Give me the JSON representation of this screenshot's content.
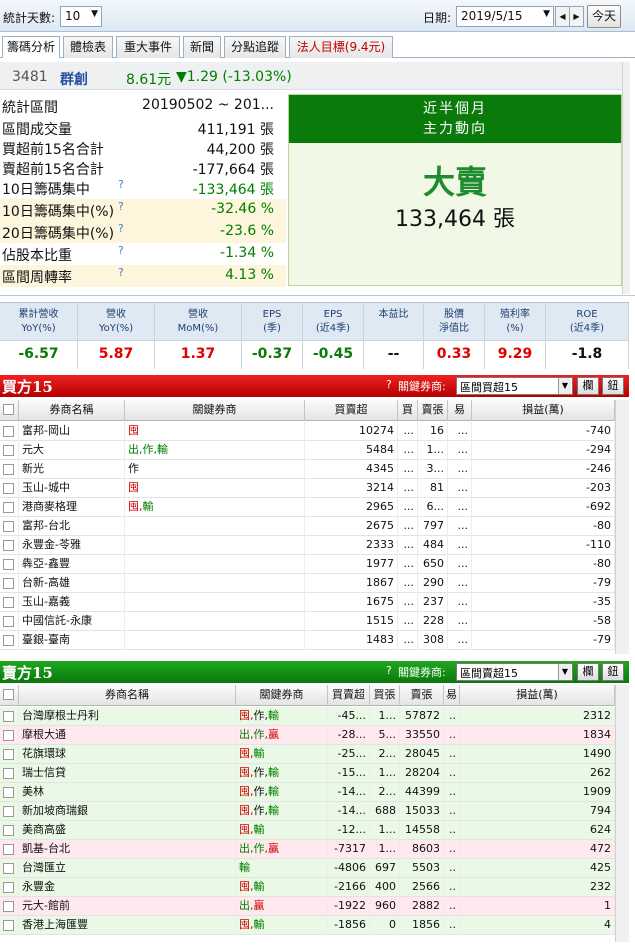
{
  "toolbar": {
    "days_label": "統計天數:",
    "days_value": "10",
    "date_label": "日期:",
    "date_value": "2019/5/15",
    "today_button": "今天"
  },
  "tabs": [
    {
      "label": "籌碼分析"
    },
    {
      "label": "體檢表"
    },
    {
      "label": "重大事件"
    },
    {
      "label": "新聞"
    },
    {
      "label": "分點追蹤"
    },
    {
      "label": "法人目標(9.4元)"
    }
  ],
  "stock": {
    "code": "3481",
    "name": "群創",
    "price": "8.61元",
    "change": "▼1.29 (-13.03%)"
  },
  "stats": [
    {
      "label": "統計區間",
      "value": "20190502 ~ 201..."
    },
    {
      "label": "區間成交量",
      "value": "411,191 張"
    },
    {
      "label": "買超前15名合計",
      "value": "44,200 張"
    },
    {
      "label": "賣超前15名合計",
      "value": "-177,664 張"
    },
    {
      "label": "10日籌碼集中",
      "value": "-133,464 張",
      "help": "?"
    },
    {
      "label": "10日籌碼集中(%)",
      "value": "-32.46 %",
      "help": "?"
    },
    {
      "label": "20日籌碼集中(%)",
      "value": "-23.6 %",
      "help": "?"
    },
    {
      "label": "佔股本比重",
      "value": "-1.34 %",
      "help": "?"
    },
    {
      "label": "區間周轉率",
      "value": "4.13 %",
      "help": "?"
    }
  ],
  "trend": {
    "line1": "近半個月",
    "line2": "主力動向",
    "verdict": "大賣",
    "amount": "133,464 張"
  },
  "metrics": [
    {
      "h1": "累計營收",
      "h2": "YoY(%)",
      "v": "-6.57",
      "color": "#0a7a0a"
    },
    {
      "h1": "營收",
      "h2": "YoY(%)",
      "v": "5.87",
      "color": "#e00000"
    },
    {
      "h1": "營收",
      "h2": "MoM(%)",
      "v": "1.37",
      "color": "#e00000"
    },
    {
      "h1": "EPS",
      "h2": "(季)",
      "v": "-0.37",
      "color": "#0a7a0a"
    },
    {
      "h1": "EPS",
      "h2": "(近4季)",
      "v": "-0.45",
      "color": "#0a7a0a"
    },
    {
      "h1": "本益比",
      "h2": "",
      "v": "--",
      "color": "#111111"
    },
    {
      "h1": "股價",
      "h2": "淨值比",
      "v": "0.33",
      "color": "#e00000"
    },
    {
      "h1": "殖利率",
      "h2": "(%)",
      "v": "9.29",
      "color": "#e00000"
    },
    {
      "h1": "ROE",
      "h2": "(近4季)",
      "v": "-1.8",
      "color": "#111111"
    }
  ],
  "buy": {
    "title": "買方15",
    "qmark": "?",
    "key_label": "關鍵券商:",
    "select": "區間買超15",
    "btn1": "欄",
    "btn2": "鈕",
    "columns": [
      "",
      "券商名稱",
      "關鍵券商",
      "買賣超",
      "買",
      "賣張",
      "易",
      "損益(萬)"
    ],
    "rows": [
      {
        "name": "富邦-岡山",
        "tags": [
          {
            "t": "囤",
            "c": "red"
          }
        ],
        "net": "10274",
        "buy": "...",
        "sell": "16",
        "e": "...",
        "pl": "-740"
      },
      {
        "name": "元大",
        "tags": [
          {
            "t": "出,作,",
            "c": "green"
          },
          {
            "t": "輸",
            "c": "green"
          }
        ],
        "net": "5484",
        "buy": "...",
        "sell": "1...",
        "e": "...",
        "pl": "-294"
      },
      {
        "name": "新光",
        "tags": [
          {
            "t": "作",
            "c": "black"
          }
        ],
        "net": "4345",
        "buy": "...",
        "sell": "3...",
        "e": "...",
        "pl": "-246"
      },
      {
        "name": "玉山-城中",
        "tags": [
          {
            "t": "囤",
            "c": "red"
          }
        ],
        "net": "3214",
        "buy": "...",
        "sell": "81",
        "e": "...",
        "pl": "-203"
      },
      {
        "name": "港商麥格理",
        "tags": [
          {
            "t": "囤,",
            "c": "red"
          },
          {
            "t": "輸",
            "c": "green"
          }
        ],
        "net": "2965",
        "buy": "...",
        "sell": "6...",
        "e": "...",
        "pl": "-692"
      },
      {
        "name": "富邦-台北",
        "tags": [],
        "net": "2675",
        "buy": "...",
        "sell": "797",
        "e": "...",
        "pl": "-80"
      },
      {
        "name": "永豐金-苓雅",
        "tags": [],
        "net": "2333",
        "buy": "...",
        "sell": "484",
        "e": "...",
        "pl": "-110"
      },
      {
        "name": "犇亞-鑫豐",
        "tags": [],
        "net": "1977",
        "buy": "...",
        "sell": "650",
        "e": "...",
        "pl": "-80"
      },
      {
        "name": "台新-高雄",
        "tags": [],
        "net": "1867",
        "buy": "...",
        "sell": "290",
        "e": "...",
        "pl": "-79"
      },
      {
        "name": "玉山-嘉義",
        "tags": [],
        "net": "1675",
        "buy": "...",
        "sell": "237",
        "e": "...",
        "pl": "-35"
      },
      {
        "name": "中國信託-永康",
        "tags": [],
        "net": "1515",
        "buy": "...",
        "sell": "228",
        "e": "...",
        "pl": "-58"
      },
      {
        "name": "臺銀-臺南",
        "tags": [],
        "net": "1483",
        "buy": "...",
        "sell": "308",
        "e": "...",
        "pl": "-79"
      }
    ]
  },
  "sell": {
    "title": "賣方15",
    "qmark": "?",
    "key_label": "關鍵券商:",
    "select": "區間賣超15",
    "btn1": "欄",
    "btn2": "鈕",
    "columns": [
      "",
      "券商名稱",
      "關鍵券商",
      "買賣超",
      "買張",
      "賣張",
      "易",
      "損益(萬)"
    ],
    "rows": [
      {
        "name": "台灣摩根士丹利",
        "tags": [
          {
            "t": "囤,",
            "c": "red"
          },
          {
            "t": "作,",
            "c": "black"
          },
          {
            "t": "輸",
            "c": "green"
          }
        ],
        "net": "-45...",
        "buy": "1...",
        "sell": "57872",
        "e": "..",
        "pl": "2312",
        "bg": "mint"
      },
      {
        "name": "摩根大通",
        "tags": [
          {
            "t": "出,作,",
            "c": "green"
          },
          {
            "t": "贏",
            "c": "red"
          }
        ],
        "net": "-28...",
        "buy": "5...",
        "sell": "33550",
        "e": "..",
        "pl": "1834",
        "bg": "pink"
      },
      {
        "name": "花旗環球",
        "tags": [
          {
            "t": "囤,",
            "c": "red"
          },
          {
            "t": "輸",
            "c": "green"
          }
        ],
        "net": "-25...",
        "buy": "2...",
        "sell": "28045",
        "e": "..",
        "pl": "1490",
        "bg": "mint"
      },
      {
        "name": "瑞士信貸",
        "tags": [
          {
            "t": "囤,",
            "c": "red"
          },
          {
            "t": "作,",
            "c": "black"
          },
          {
            "t": "輸",
            "c": "green"
          }
        ],
        "net": "-15...",
        "buy": "1...",
        "sell": "28204",
        "e": "..",
        "pl": "262",
        "bg": "mint"
      },
      {
        "name": "美林",
        "tags": [
          {
            "t": "囤,",
            "c": "red"
          },
          {
            "t": "作,",
            "c": "black"
          },
          {
            "t": "輸",
            "c": "green"
          }
        ],
        "net": "-14...",
        "buy": "2...",
        "sell": "44399",
        "e": "..",
        "pl": "1909",
        "bg": "mint"
      },
      {
        "name": "新加坡商瑞銀",
        "tags": [
          {
            "t": "囤,",
            "c": "red"
          },
          {
            "t": "作,",
            "c": "black"
          },
          {
            "t": "輸",
            "c": "green"
          }
        ],
        "net": "-14...",
        "buy": "688",
        "sell": "15033",
        "e": "..",
        "pl": "794",
        "bg": "mint"
      },
      {
        "name": "美商高盛",
        "tags": [
          {
            "t": "囤,",
            "c": "red"
          },
          {
            "t": "輸",
            "c": "green"
          }
        ],
        "net": "-12...",
        "buy": "1...",
        "sell": "14558",
        "e": "..",
        "pl": "624",
        "bg": "mint"
      },
      {
        "name": "凱基-台北",
        "tags": [
          {
            "t": "出,作,",
            "c": "green"
          },
          {
            "t": "贏",
            "c": "red"
          }
        ],
        "net": "-7317",
        "buy": "1...",
        "sell": "8603",
        "e": "..",
        "pl": "472",
        "bg": "pink"
      },
      {
        "name": "台灣匯立",
        "tags": [
          {
            "t": "輸",
            "c": "green"
          }
        ],
        "net": "-4806",
        "buy": "697",
        "sell": "5503",
        "e": "..",
        "pl": "425",
        "bg": "mint"
      },
      {
        "name": "永豐金",
        "tags": [
          {
            "t": "囤,",
            "c": "red"
          },
          {
            "t": "輸",
            "c": "green"
          }
        ],
        "net": "-2166",
        "buy": "400",
        "sell": "2566",
        "e": "..",
        "pl": "232",
        "bg": "mint"
      },
      {
        "name": "元大-館前",
        "tags": [
          {
            "t": "出,",
            "c": "green"
          },
          {
            "t": "贏",
            "c": "red"
          }
        ],
        "net": "-1922",
        "buy": "960",
        "sell": "2882",
        "e": "..",
        "pl": "1",
        "bg": "pink"
      },
      {
        "name": "香港上海匯豐",
        "tags": [
          {
            "t": "囤,",
            "c": "red"
          },
          {
            "t": "輸",
            "c": "green"
          }
        ],
        "net": "-1856",
        "buy": "0",
        "sell": "1856",
        "e": "..",
        "pl": "4",
        "bg": "mint"
      }
    ]
  }
}
